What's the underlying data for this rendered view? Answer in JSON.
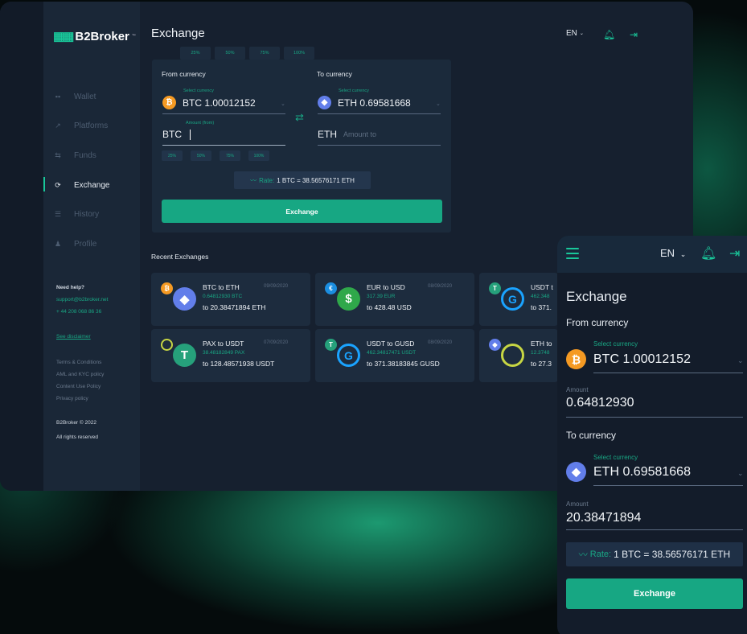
{
  "app": {
    "brand": "B2Broker",
    "brand_tm": "™"
  },
  "colors": {
    "accent": "#19A784",
    "panel": "#1B2A3B",
    "bitcoin": "#F59A23",
    "ethereum": "#627EEA"
  },
  "sidebar": {
    "items": [
      {
        "label": "Wallet",
        "icon": "grid-icon"
      },
      {
        "label": "Platforms",
        "icon": "chart-icon"
      },
      {
        "label": "Funds",
        "icon": "transfer-icon"
      },
      {
        "label": "Exchange",
        "icon": "exchange-icon",
        "active": true
      },
      {
        "label": "History",
        "icon": "list-icon"
      },
      {
        "label": "Profile",
        "icon": "user-icon"
      }
    ],
    "help_title": "Need help?",
    "help_email": "support@b2broker.net",
    "help_phone": "+ 44 208 068 86 36",
    "disclaimer": "See disclaimer",
    "links": [
      "Terms & Conditions",
      "AML and KYC policy",
      "Content Use Policy",
      "Privacy policy"
    ],
    "copyright": "B2Broker © 2022",
    "rights": "All rights reserved"
  },
  "header": {
    "title": "Exchange",
    "language": "EN"
  },
  "percent_options": [
    "25%",
    "50%",
    "75%",
    "100%"
  ],
  "exchange_form": {
    "from_label": "From currency",
    "to_label": "To currency",
    "select_label": "Select currency",
    "from_currency": "BTC 1.00012152",
    "to_currency": "ETH 0.69581668",
    "amount_from_label": "Amount (from)",
    "from_code": "BTC",
    "from_amount_value": "",
    "to_code": "ETH",
    "amount_to_placeholder": "Amount to",
    "rate_label": "Rate:",
    "rate_value": "1 BTC = 38.56576171  ETH",
    "submit": "Exchange"
  },
  "recent": {
    "title": "Recent Exchanges",
    "items": [
      {
        "pair": "BTC  to  ETH",
        "date": "09/09/2020",
        "from": "0.64812930 BTC",
        "to": "to  20.38471894 ETH"
      },
      {
        "pair": "EUR  to  USD",
        "date": "08/09/2020",
        "from": "317.39 EUR",
        "to": "to  428.48 USD"
      },
      {
        "pair": "USDT  t",
        "date": "",
        "from": "462.348",
        "to": "to  371."
      },
      {
        "pair": "PAX  to  USDT",
        "date": "07/09/2020",
        "from": "38.48182849 PAX",
        "to": "to  128.48571938 USDT"
      },
      {
        "pair": "USDT  to  GUSD",
        "date": "08/09/2020",
        "from": "462.34817471 USDT",
        "to": "to  371.38183845 GUSD"
      },
      {
        "pair": "ETH  to",
        "date": "",
        "from": "12.3748",
        "to": "to  27.3"
      }
    ]
  },
  "mobile": {
    "language": "EN",
    "title": "Exchange",
    "from_label": "From currency",
    "select_label": "Select currency",
    "from_currency": "BTC 1.00012152",
    "amount_label": "Amount",
    "from_amount": "0.64812930",
    "to_label": "To currency",
    "to_currency": "ETH 0.69581668",
    "to_amount": "20.38471894",
    "rate_label": "Rate:",
    "rate_value": "1 BTC = 38.56576171  ETH",
    "submit": "Exchange"
  }
}
